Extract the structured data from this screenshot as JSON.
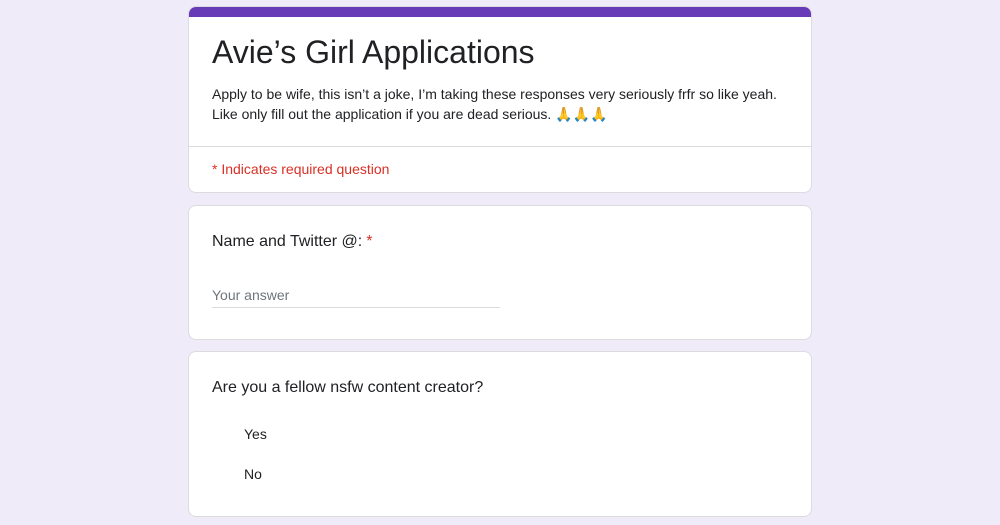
{
  "form": {
    "title": "Avie’s Girl Applications",
    "description": "Apply to be wife, this isn’t a joke, I’m taking these responses very seriously frfr so like yeah. Like only fill out the application if you are dead serious. 🙏🙏🙏",
    "required_note": "* Indicates required question",
    "accent_color": "#673ab7",
    "required_color": "#d93025",
    "background_color": "#f0ebf8"
  },
  "questions": [
    {
      "title": "Name and Twitter @:",
      "required_mark": "*",
      "input_placeholder": "Your answer",
      "input_value": ""
    },
    {
      "title": "Are you a fellow nsfw content creator?",
      "options": [
        "Yes",
        "No"
      ]
    }
  ]
}
